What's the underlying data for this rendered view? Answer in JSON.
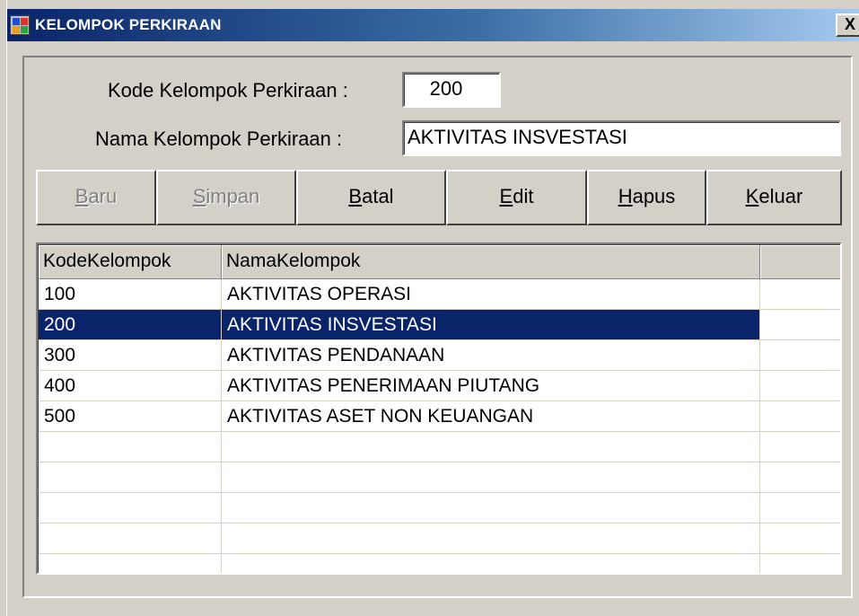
{
  "window": {
    "title": "KELOMPOK PERKIRAAN",
    "close_label": "X",
    "icon": "app-form-icon"
  },
  "form": {
    "kode_label": "Kode Kelompok Perkiraan :",
    "kode_value": "200",
    "nama_label": "Nama Kelompok Perkiraan :",
    "nama_value": "AKTIVITAS INSVESTASI"
  },
  "toolbar": {
    "baru": {
      "hotkey": "B",
      "rest": "aru",
      "enabled": false
    },
    "simpan": {
      "hotkey": "S",
      "rest": "impan",
      "enabled": false
    },
    "batal": {
      "hotkey": "B",
      "rest": "atal",
      "enabled": true
    },
    "edit": {
      "hotkey": "E",
      "rest": "dit",
      "enabled": true
    },
    "hapus": {
      "hotkey": "H",
      "rest": "apus",
      "enabled": true
    },
    "keluar": {
      "hotkey": "K",
      "rest": "eluar",
      "enabled": true
    }
  },
  "grid": {
    "columns": [
      "KodeKelompok",
      "NamaKelompok",
      ""
    ],
    "rows": [
      {
        "kode": "100",
        "nama": "AKTIVITAS OPERASI"
      },
      {
        "kode": "200",
        "nama": "AKTIVITAS INSVESTASI"
      },
      {
        "kode": "300",
        "nama": "AKTIVITAS PENDANAAN"
      },
      {
        "kode": "400",
        "nama": "AKTIVITAS PENERIMAAN PIUTANG"
      },
      {
        "kode": "500",
        "nama": "AKTIVITAS ASET NON KEUANGAN"
      }
    ],
    "selected_row": 1
  },
  "colors": {
    "selection": "#0a246a",
    "face": "#d4d0c8",
    "title_start": "#0a246a",
    "title_end": "#a6caf0"
  }
}
